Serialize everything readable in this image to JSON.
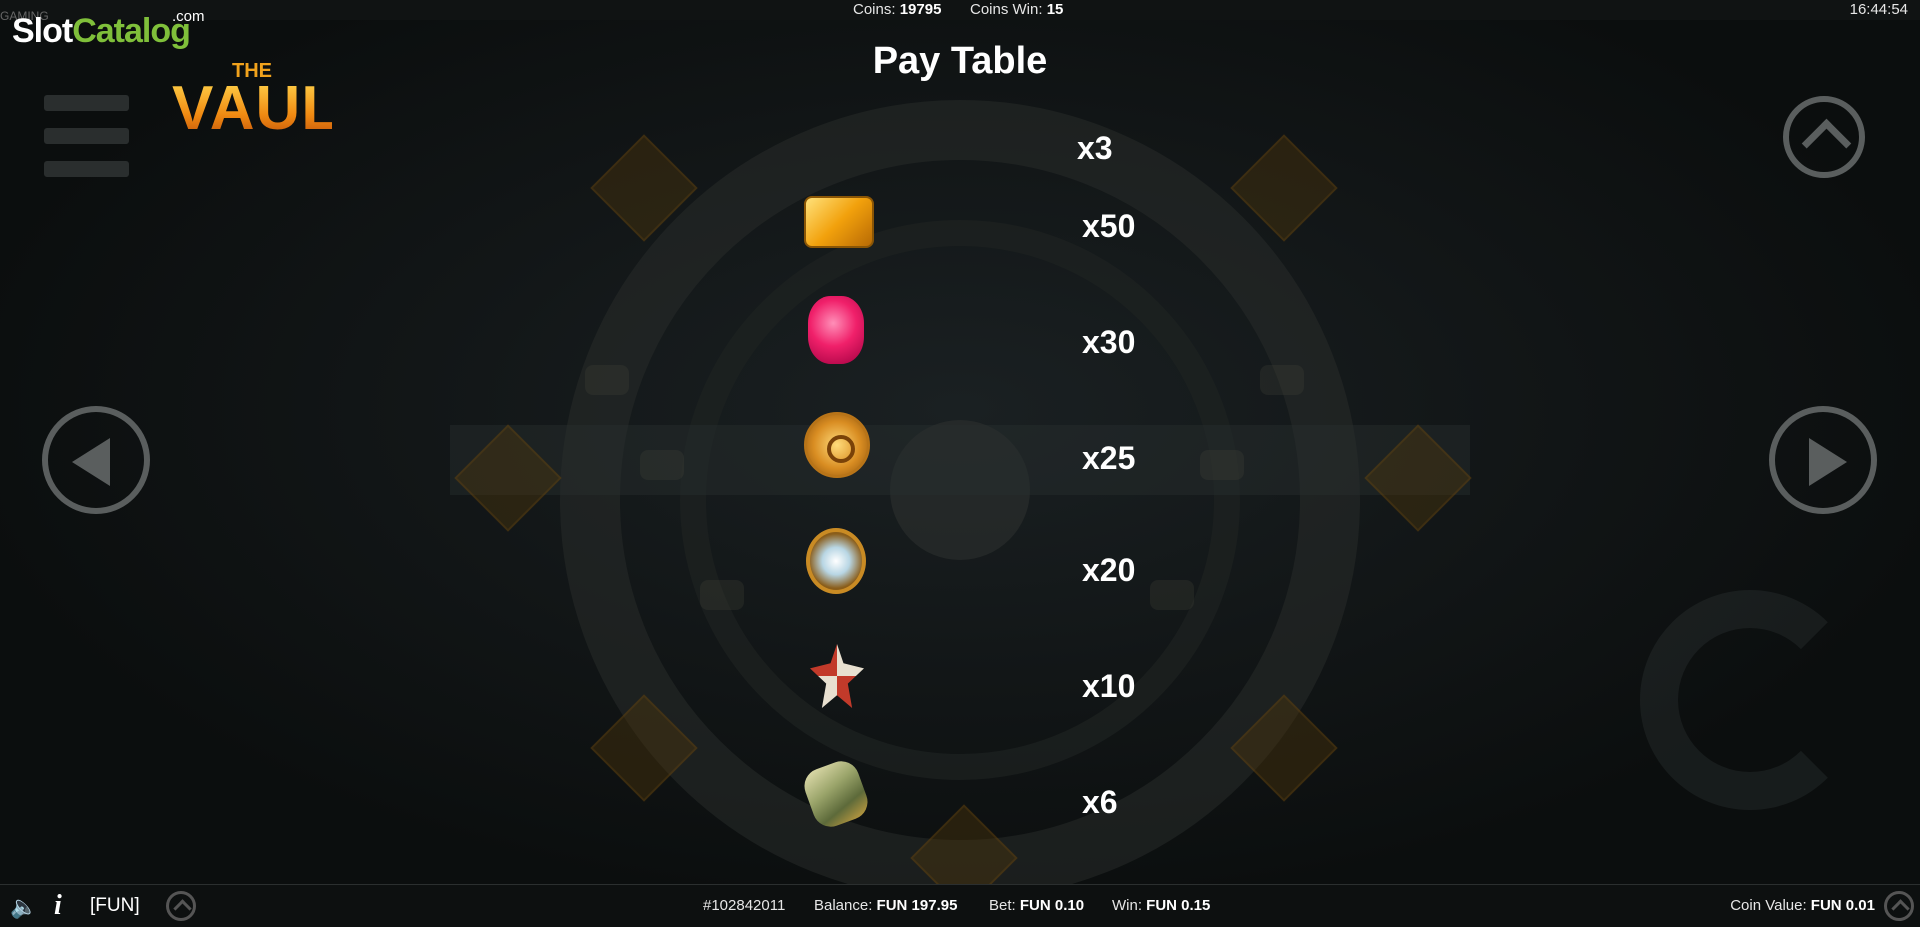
{
  "top_bar": {
    "provider_watermark": "GAMING",
    "coins_label": "Coins:",
    "coins_value": "19795",
    "coins_win_label": "Coins Win:",
    "coins_win_value": "15",
    "clock": "16:44:54"
  },
  "watermark": {
    "slot": "Slot",
    "catalog": "Catalog",
    "com": ".com"
  },
  "game_logo": {
    "the": "THE",
    "vault": "VAULT"
  },
  "pay_table": {
    "title": "Pay Table",
    "header_multiplier": "x3",
    "rows": [
      {
        "symbol": "gold-bar-icon",
        "multiplier": "x50"
      },
      {
        "symbol": "ruby-gem-icon",
        "multiplier": "x30"
      },
      {
        "symbol": "gold-coin-icon",
        "multiplier": "x25"
      },
      {
        "symbol": "diamond-amulet-icon",
        "multiplier": "x20"
      },
      {
        "symbol": "medal-icon",
        "multiplier": "x10"
      },
      {
        "symbol": "cash-roll-icon",
        "multiplier": "x6"
      }
    ]
  },
  "bottom_bar": {
    "mode": "[FUN]",
    "round_id": "#102842011",
    "balance_label": "Balance:",
    "balance_value": "FUN 197.95",
    "bet_label": "Bet:",
    "bet_value": "FUN 0.10",
    "win_label": "Win:",
    "win_value": "FUN 0.15",
    "coin_value_label": "Coin Value:",
    "coin_value_value": "FUN 0.01"
  },
  "colors": {
    "accent_green": "#7fbf3a",
    "logo_orange": "#f08a12",
    "background": "#0c0f0f"
  }
}
